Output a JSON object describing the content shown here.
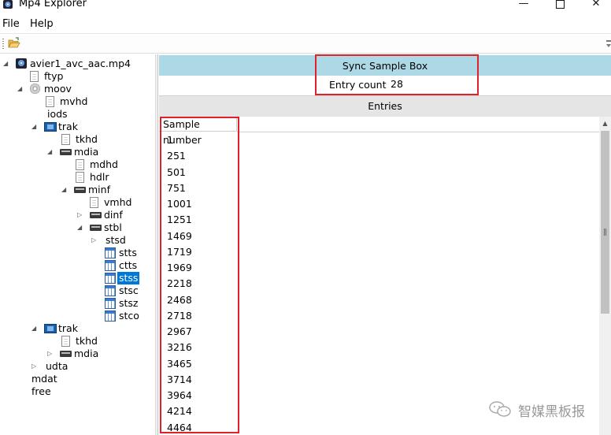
{
  "window": {
    "title": "Mp4 Explorer",
    "controls": {
      "minimize": "—",
      "maximize": "",
      "close": "✕"
    }
  },
  "menu": {
    "items": [
      "File",
      "Help"
    ]
  },
  "toolbar": {
    "open_icon": "folder-open-icon"
  },
  "tree": {
    "root": "avier1_avc_aac.mp4",
    "nodes": [
      {
        "label": "avier1_avc_aac.mp4",
        "icon": "mp4-file-icon",
        "arrow": "◢"
      },
      {
        "label": "ftyp",
        "icon": "document-icon"
      },
      {
        "label": "moov",
        "icon": "disc-icon",
        "arrow": "◢"
      },
      {
        "label": "mvhd",
        "icon": "document-icon"
      },
      {
        "label": "iods"
      },
      {
        "label": "trak",
        "icon": "film-icon",
        "arrow": "◢"
      },
      {
        "label": "tkhd",
        "icon": "document-icon"
      },
      {
        "label": "mdia",
        "icon": "box-icon",
        "arrow": "◢"
      },
      {
        "label": "mdhd",
        "icon": "document-icon"
      },
      {
        "label": "hdlr",
        "icon": "document-icon"
      },
      {
        "label": "minf",
        "icon": "box-icon",
        "arrow": "◢"
      },
      {
        "label": "vmhd",
        "icon": "document-icon"
      },
      {
        "label": "dinf",
        "icon": "box-icon",
        "arrow": "▷"
      },
      {
        "label": "stbl",
        "icon": "box-icon",
        "arrow": "◢"
      },
      {
        "label": "stsd",
        "arrow": "▷"
      },
      {
        "label": "stts",
        "icon": "table-icon"
      },
      {
        "label": "ctts",
        "icon": "table-icon"
      },
      {
        "label": "stss",
        "icon": "table-icon",
        "selected": true
      },
      {
        "label": "stsc",
        "icon": "table-icon"
      },
      {
        "label": "stsz",
        "icon": "table-icon"
      },
      {
        "label": "stco",
        "icon": "table-icon"
      },
      {
        "label": "trak",
        "icon": "film-icon",
        "arrow": "◢"
      },
      {
        "label": "tkhd",
        "icon": "document-icon"
      },
      {
        "label": "mdia",
        "icon": "box-icon",
        "arrow": "▷"
      },
      {
        "label": "udta",
        "arrow": "▷"
      },
      {
        "label": "mdat"
      },
      {
        "label": "free"
      }
    ]
  },
  "detail": {
    "box_title": "Sync Sample Box",
    "entry_count_label": "Entry count:",
    "entry_count_value": "28",
    "entries_title": "Entries",
    "column_header": "Sample number",
    "samples": [
      "1",
      "251",
      "501",
      "751",
      "1001",
      "1251",
      "1469",
      "1719",
      "1969",
      "2218",
      "2468",
      "2718",
      "2967",
      "3216",
      "3465",
      "3714",
      "3964",
      "4214",
      "4464"
    ]
  },
  "watermark": {
    "text": "智媒黑板报",
    "icon": "wechat-icon"
  },
  "colors": {
    "header_blue": "#add8e6",
    "selection": "#0078d7",
    "highlight_red": "#e0202a"
  }
}
